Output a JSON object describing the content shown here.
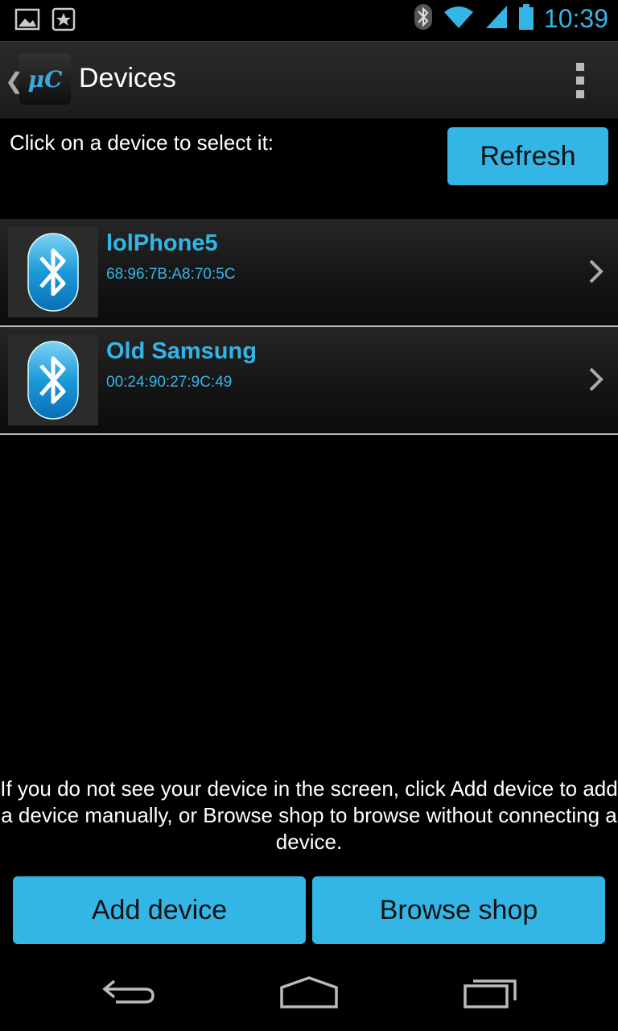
{
  "status_bar": {
    "time": "10:39",
    "icons": [
      "image-icon",
      "bookmark-icon",
      "bluetooth-icon",
      "wifi-icon",
      "signal-icon",
      "battery-icon"
    ]
  },
  "action_bar": {
    "title": "Devices",
    "logo_text": "μC"
  },
  "main": {
    "instruction": "Click on a device to select it:",
    "refresh_label": "Refresh",
    "devices": [
      {
        "name": "lolPhone5",
        "mac": "68:96:7B:A8:70:5C"
      },
      {
        "name": "Old Samsung",
        "mac": "00:24:90:27:9C:49"
      }
    ],
    "help_text": "If you do not see your device in the screen, click Add device to add a device manually, or Browse shop to browse without connecting a device.",
    "add_device_label": "Add device",
    "browse_shop_label": "Browse shop"
  },
  "colors": {
    "accent": "#33b5e5",
    "background": "#000000"
  }
}
